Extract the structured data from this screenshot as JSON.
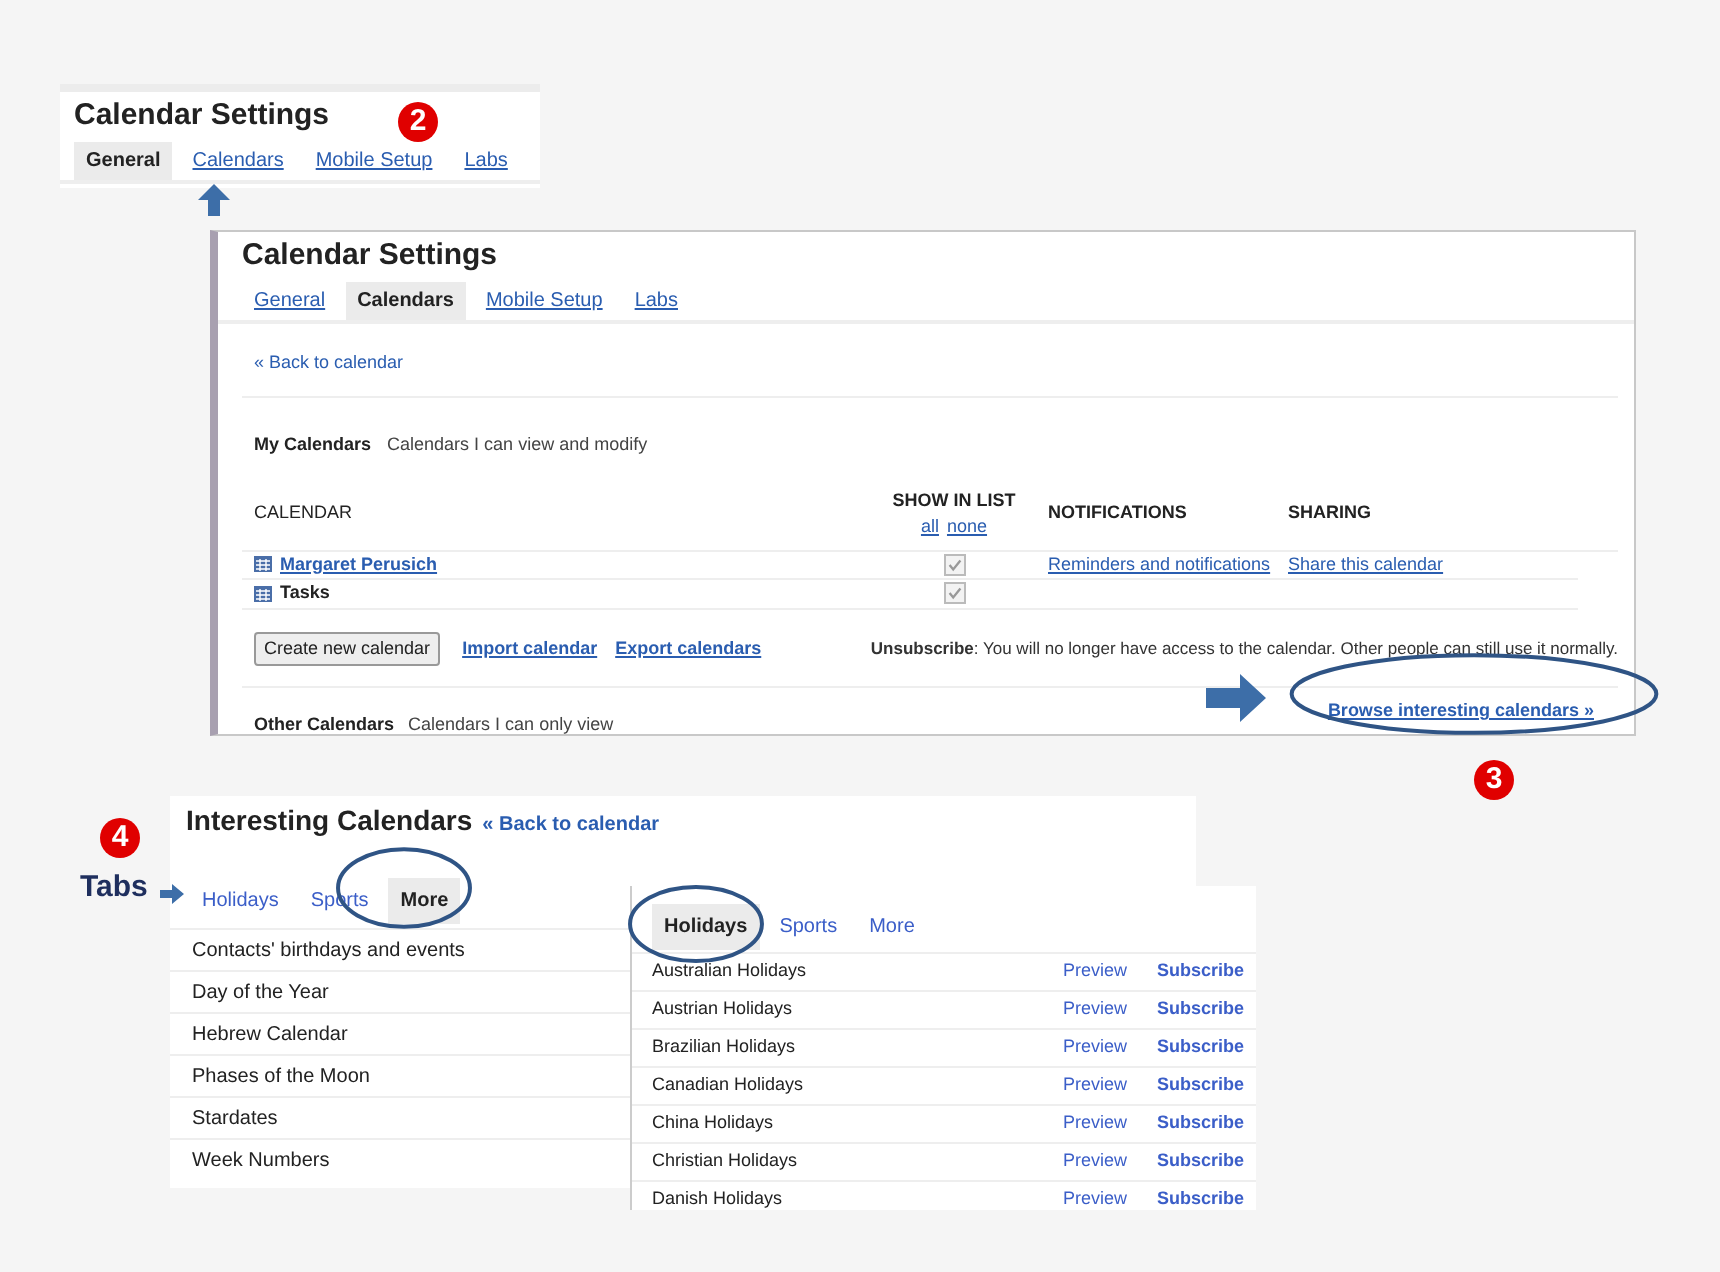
{
  "settings_preview": {
    "title": "Calendar Settings",
    "callout": "2",
    "tabs": [
      {
        "label": "General",
        "selected": true
      },
      {
        "label": "Calendars",
        "selected": false
      },
      {
        "label": "Mobile Setup",
        "selected": false
      },
      {
        "label": "Labs",
        "selected": false
      }
    ]
  },
  "settings": {
    "title": "Calendar Settings",
    "tabs": [
      {
        "label": "General",
        "selected": false
      },
      {
        "label": "Calendars",
        "selected": true
      },
      {
        "label": "Mobile Setup",
        "selected": false
      },
      {
        "label": "Labs",
        "selected": false
      }
    ],
    "back_link": "« Back to calendar",
    "my_calendars": {
      "heading": "My Calendars",
      "description": "Calendars I can view and modify"
    },
    "columns": [
      "CALENDAR",
      "SHOW IN LIST",
      "NOTIFICATIONS",
      "SHARING"
    ],
    "show_links": [
      "all",
      "none"
    ],
    "rows": [
      {
        "name": "Margaret Perusich",
        "kind": "link",
        "checked": true,
        "notifications": "Reminders and notifications",
        "sharing": "Share this calendar"
      },
      {
        "name": "Tasks",
        "kind": "plain",
        "checked": true
      }
    ],
    "create_button": "Create new calendar",
    "import_link": "Import calendar",
    "export_link": "Export calendars",
    "unsubscribe_note": "**Unsubscribe**: You will no longer have access to the calendar. Other people can still use it normally.",
    "other_calendars": {
      "heading": "Other Calendars",
      "description": "Calendars I can only view"
    },
    "browse_link": "Browse interesting calendars »",
    "callout": "3"
  },
  "interesting": {
    "title": "Interesting Calendars",
    "back_link": "« Back to calendar",
    "callout": "4",
    "callout_label": "Tabs",
    "tabs": [
      {
        "label": "Holidays",
        "selected": false
      },
      {
        "label": "Sports",
        "selected": false
      },
      {
        "label": "More",
        "selected": true
      }
    ],
    "more_items": [
      "Contacts' birthdays and events",
      "Day of the Year",
      "Hebrew Calendar",
      "Phases of the Moon",
      "Stardates",
      "Week Numbers"
    ],
    "holidays_panel": {
      "tabs": [
        {
          "label": "Holidays",
          "selected": true
        },
        {
          "label": "Sports",
          "selected": false
        },
        {
          "label": "More",
          "selected": false
        }
      ],
      "rows": [
        {
          "name": "Australian Holidays",
          "preview": "Preview",
          "subscribe": "Subscribe"
        },
        {
          "name": "Austrian Holidays",
          "preview": "Preview",
          "subscribe": "Subscribe"
        },
        {
          "name": "Brazilian Holidays",
          "preview": "Preview",
          "subscribe": "Subscribe"
        },
        {
          "name": "Canadian Holidays",
          "preview": "Preview",
          "subscribe": "Subscribe"
        },
        {
          "name": "China Holidays",
          "preview": "Preview",
          "subscribe": "Subscribe"
        },
        {
          "name": "Christian Holidays",
          "preview": "Preview",
          "subscribe": "Subscribe"
        },
        {
          "name": "Danish Holidays",
          "preview": "Preview",
          "subscribe": "Subscribe"
        }
      ]
    }
  }
}
